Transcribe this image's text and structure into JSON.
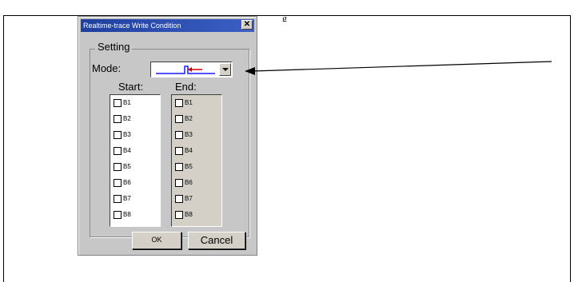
{
  "page": {
    "top_mark": "g"
  },
  "dialog": {
    "title": "Realtime-trace Write Condition",
    "close_glyph": "✕",
    "group_label": "Setting",
    "mode_label": "Mode:",
    "start_label": "Start:",
    "end_label": "End:",
    "start_items": [
      "B1",
      "B2",
      "B3",
      "B4",
      "B5",
      "B6",
      "B7",
      "B8"
    ],
    "end_items": [
      "B1",
      "B2",
      "B3",
      "B4",
      "B5",
      "B6",
      "B7",
      "B8"
    ],
    "ok_label": "OK",
    "cancel_label": "Cancel"
  },
  "colors": {
    "titlebar": "#1f3f9e",
    "dialog_bg": "#c7c7c7",
    "mode_trace": "#1a1aff",
    "mode_marker": "#d00000"
  },
  "icons": {
    "close": "close-icon",
    "dropdown": "chevron-down-icon",
    "mode": "trace-mode-icon"
  }
}
